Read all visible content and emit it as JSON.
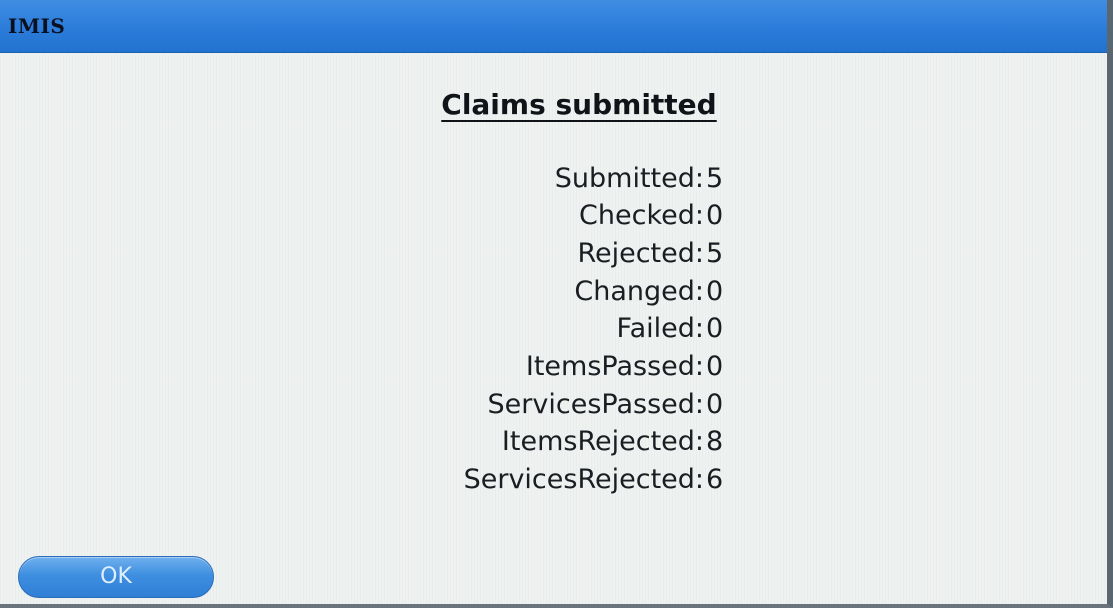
{
  "window": {
    "title": "IMIS"
  },
  "dialog": {
    "heading": "Claims submitted",
    "stats": [
      {
        "label": "Submitted:",
        "value": "5"
      },
      {
        "label": "Checked:",
        "value": "0"
      },
      {
        "label": "Rejected:",
        "value": "5"
      },
      {
        "label": "Changed:",
        "value": "0"
      },
      {
        "label": "Failed:",
        "value": "0"
      },
      {
        "label": "ItemsPassed:",
        "value": "0"
      },
      {
        "label": "ServicesPassed:",
        "value": "0"
      },
      {
        "label": "ItemsRejected:",
        "value": "8"
      },
      {
        "label": "ServicesRejected:",
        "value": "6"
      }
    ],
    "ok_label": "OK"
  },
  "colors": {
    "titlebar": "#2a7bd9",
    "background": "#eef2f1",
    "button": "#3e8fe0"
  }
}
